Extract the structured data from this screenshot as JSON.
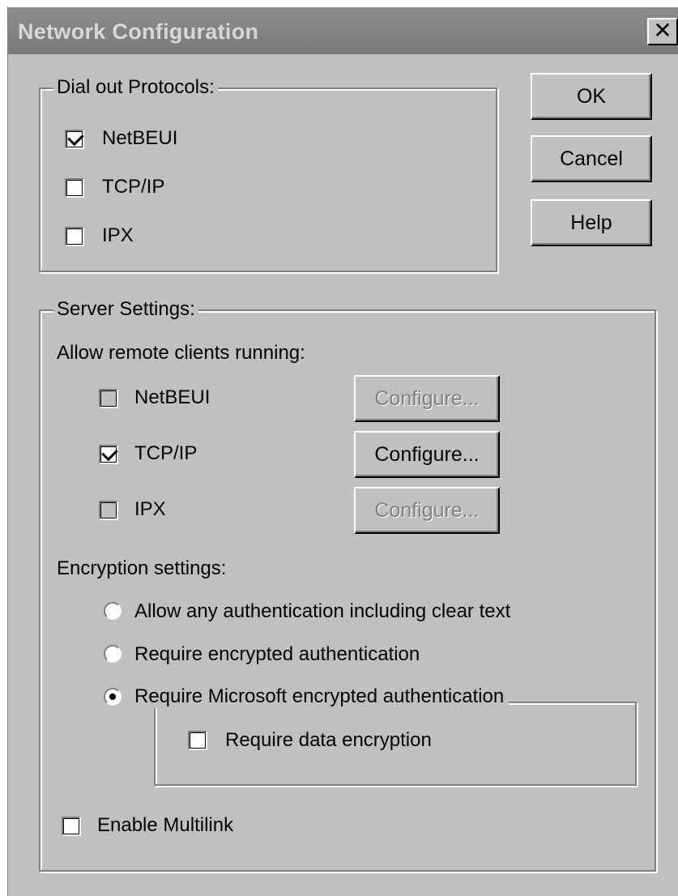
{
  "window": {
    "title": "Network Configuration",
    "close_glyph": "✕"
  },
  "buttons": {
    "ok": "OK",
    "cancel": "Cancel",
    "help": "Help"
  },
  "dial_out": {
    "legend": "Dial out Protocols:",
    "items": [
      {
        "label": "NetBEUI",
        "checked": true
      },
      {
        "label": "TCP/IP",
        "checked": false
      },
      {
        "label": "IPX",
        "checked": false
      }
    ]
  },
  "server": {
    "legend": "Server Settings:",
    "allow_label": "Allow remote clients running:",
    "clients": [
      {
        "label": "NetBEUI",
        "checked": false,
        "configure": "Configure...",
        "configure_enabled": false
      },
      {
        "label": "TCP/IP",
        "checked": true,
        "configure": "Configure...",
        "configure_enabled": true
      },
      {
        "label": "IPX",
        "checked": false,
        "configure": "Configure...",
        "configure_enabled": false
      }
    ],
    "encryption_label": "Encryption settings:",
    "encryption_options": [
      {
        "label": "Allow any authentication including clear text",
        "selected": false
      },
      {
        "label": "Require encrypted authentication",
        "selected": false
      },
      {
        "label": "Require Microsoft encrypted authentication",
        "selected": true
      }
    ],
    "data_encryption": {
      "label": "Require data encryption",
      "checked": false
    },
    "multilink": {
      "label": "Enable Multilink",
      "checked": false
    }
  }
}
